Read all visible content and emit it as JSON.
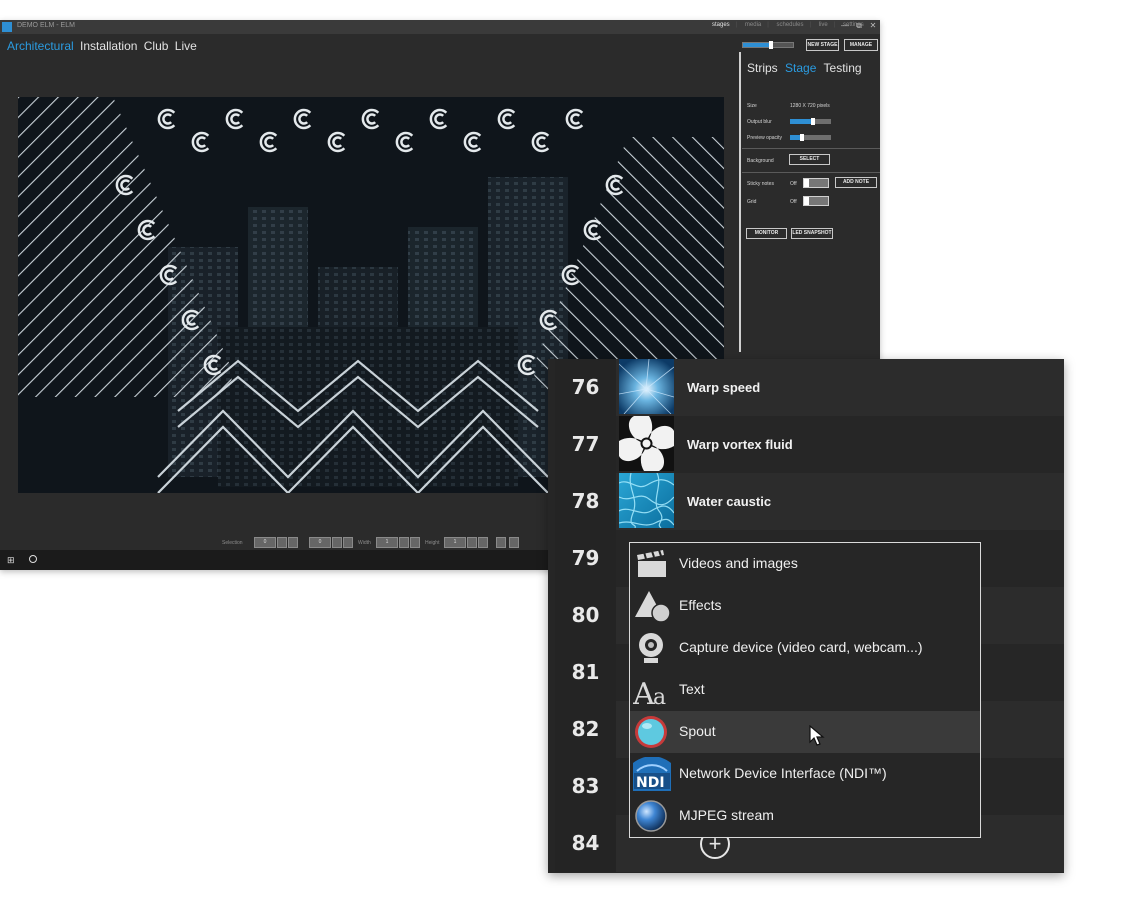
{
  "window": {
    "title": "DEMO ELM - ELM",
    "top_menu": [
      "stages",
      "media",
      "schedules",
      "live",
      "settings"
    ],
    "top_menu_active": "stages",
    "window_buttons": [
      "—",
      "⧉",
      "✕"
    ]
  },
  "nav_tabs": {
    "items": [
      "Architectural",
      "Installation",
      "Club",
      "Live"
    ],
    "active": "Architectural"
  },
  "top_controls": {
    "slider_value": 0.55,
    "new_stage_label": "NEW STAGE",
    "manage_label": "MANAGE"
  },
  "sidebar": {
    "tabs": [
      "Strips",
      "Stage",
      "Testing"
    ],
    "active_tab": "Stage",
    "size_label": "Size",
    "size_value": "1280 X 720 pixels",
    "output_blur_label": "Output blur",
    "output_blur_value": 0.55,
    "preview_opacity_label": "Preview opacity",
    "preview_opacity_value": 0.3,
    "background_label": "Background",
    "select_label": "SELECT",
    "sticky_notes_label": "Sticky notes",
    "sticky_notes_state": "Off",
    "add_note_label": "ADD NOTE",
    "grid_label": "Grid",
    "grid_state": "Off",
    "monitor_label": "MONITOR",
    "led_snapshot_label": "LED SNAPSHOT"
  },
  "stage_toolbar": {
    "selection_label": "Selection",
    "selection_x": "0",
    "selection_y": "0",
    "width_label": "Width",
    "width_value": "1",
    "height_label": "Height",
    "height_value": "1"
  },
  "layers": [
    {
      "number": "76",
      "name": "Warp speed",
      "thumb": "warp-speed-thumbnail"
    },
    {
      "number": "77",
      "name": "Warp vortex fluid",
      "thumb": "warp-vortex-thumbnail"
    },
    {
      "number": "78",
      "name": "Water caustic",
      "thumb": "water-caustic-thumbnail"
    },
    {
      "number": "79",
      "name": ""
    },
    {
      "number": "80",
      "name": ""
    },
    {
      "number": "81",
      "name": ""
    },
    {
      "number": "82",
      "name": ""
    },
    {
      "number": "83",
      "name": ""
    },
    {
      "number": "84",
      "name": ""
    }
  ],
  "add_layer_symbol": "+",
  "source_menu": {
    "items": [
      {
        "label": "Videos and images",
        "icon": "clapperboard-icon"
      },
      {
        "label": "Effects",
        "icon": "shapes-icon"
      },
      {
        "label": "Capture device (video card, webcam...)",
        "icon": "webcam-icon"
      },
      {
        "label": "Text",
        "icon": "text-aa-icon"
      },
      {
        "label": "Spout",
        "icon": "spout-icon"
      },
      {
        "label": "Network Device Interface (NDI™)",
        "icon": "ndi-icon"
      },
      {
        "label": "MJPEG stream",
        "icon": "mjpeg-sphere-icon"
      }
    ],
    "hovered_index": 4
  },
  "colors": {
    "accent": "#2b9be0",
    "panel": "#2b2b2b",
    "layer_panel": "#262626"
  }
}
